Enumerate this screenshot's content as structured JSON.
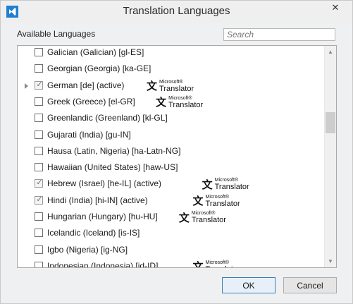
{
  "window": {
    "title": "Translation Languages"
  },
  "available_label": "Available Languages",
  "search": {
    "placeholder": "Search"
  },
  "ms_logo": {
    "line1": "Microsoft®",
    "line2": "Translator"
  },
  "languages": [
    {
      "label": "Galician (Galician) [gl-ES]",
      "checked": false,
      "active": false,
      "translator": false,
      "expander": false
    },
    {
      "label": "Georgian (Georgia) [ka-GE]",
      "checked": false,
      "active": false,
      "translator": false,
      "expander": false
    },
    {
      "label": "German [de] (active)",
      "checked": true,
      "active": true,
      "translator": true,
      "expander": true
    },
    {
      "label": "Greek (Greece) [el-GR]",
      "checked": false,
      "active": false,
      "translator": true,
      "expander": false
    },
    {
      "label": "Greenlandic (Greenland) [kl-GL]",
      "checked": false,
      "active": false,
      "translator": false,
      "expander": false
    },
    {
      "label": "Gujarati (India) [gu-IN]",
      "checked": false,
      "active": false,
      "translator": false,
      "expander": false
    },
    {
      "label": "Hausa (Latin, Nigeria) [ha-Latn-NG]",
      "checked": false,
      "active": false,
      "translator": false,
      "expander": false
    },
    {
      "label": "Hawaiian (United States) [haw-US]",
      "checked": false,
      "active": false,
      "translator": false,
      "expander": false
    },
    {
      "label": "Hebrew (Israel) [he-IL] (active)",
      "checked": true,
      "active": true,
      "translator": true,
      "expander": false
    },
    {
      "label": "Hindi (India) [hi-IN] (active)",
      "checked": true,
      "active": true,
      "translator": true,
      "expander": false
    },
    {
      "label": "Hungarian (Hungary) [hu-HU]",
      "checked": false,
      "active": false,
      "translator": true,
      "expander": false
    },
    {
      "label": "Icelandic (Iceland) [is-IS]",
      "checked": false,
      "active": false,
      "translator": false,
      "expander": false
    },
    {
      "label": "Igbo (Nigeria) [ig-NG]",
      "checked": false,
      "active": false,
      "translator": false,
      "expander": false
    },
    {
      "label": "Indonesian (Indonesia) [id-ID]",
      "checked": false,
      "active": false,
      "translator": true,
      "expander": false
    }
  ],
  "buttons": {
    "ok": "OK",
    "cancel": "Cancel"
  }
}
